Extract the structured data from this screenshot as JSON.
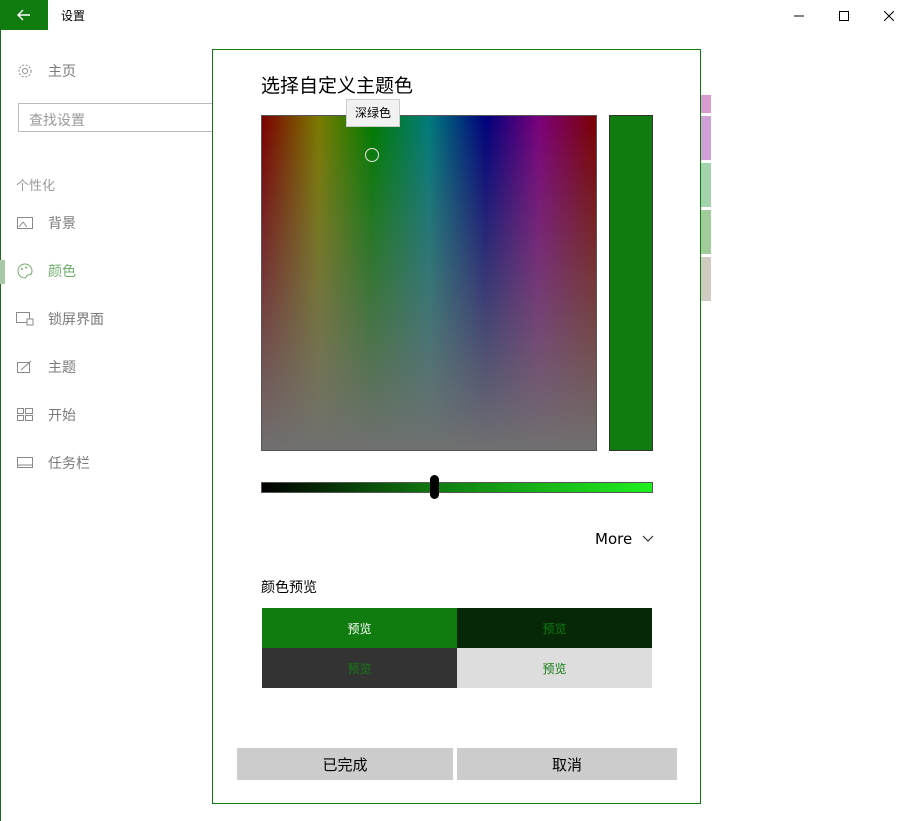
{
  "window": {
    "title": "设置",
    "back_icon": "back-arrow-icon",
    "accent": "#107c10"
  },
  "sidebar": {
    "home_label": "主页",
    "search_placeholder": "查找设置",
    "section_label": "个性化",
    "items": [
      {
        "label": "背景",
        "icon": "picture-icon",
        "active": false
      },
      {
        "label": "颜色",
        "icon": "palette-icon",
        "active": true
      },
      {
        "label": "锁屏界面",
        "icon": "lock-screen-icon",
        "active": false
      },
      {
        "label": "主题",
        "icon": "theme-brush-icon",
        "active": false
      },
      {
        "label": "开始",
        "icon": "start-tiles-icon",
        "active": false
      },
      {
        "label": "任务栏",
        "icon": "taskbar-icon",
        "active": false
      }
    ]
  },
  "dialog": {
    "title": "选择自定义主题色",
    "tooltip": "深绿色",
    "selected_color": "#107c10",
    "more_label": "More",
    "preview_label": "颜色预览",
    "preview_text": "预览",
    "preview_colors": {
      "accent_bg": "#107c10",
      "dark_accent_bg": "#062806",
      "dark_bg": "#333333",
      "light_bg": "#dddddd"
    },
    "done_label": "已完成",
    "cancel_label": "取消"
  }
}
